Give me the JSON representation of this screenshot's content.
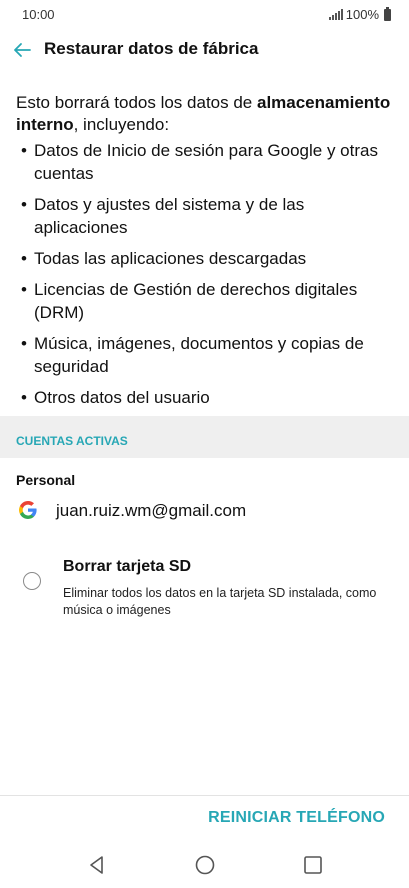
{
  "status": {
    "time": "10:00",
    "battery": "100%"
  },
  "appbar": {
    "title": "Restaurar datos de fábrica"
  },
  "intro": {
    "text_prefix": "Esto borrará todos los datos de ",
    "text_bold": "almacenamiento interno",
    "text_suffix": ", incluyendo:"
  },
  "bullets": [
    "Datos de Inicio de sesión para Google y otras cuentas",
    "Datos y ajustes del sistema y de las aplicaciones",
    "Todas las aplicaciones descargadas",
    "Licencias de Gestión de derechos digitales (DRM)",
    "Música, imágenes, documentos y copias de seguridad",
    "Otros datos del usuario"
  ],
  "accounts": {
    "section_label": "CUENTAS ACTIVAS",
    "group_label": "Personal",
    "email": "juan.ruiz.wm@gmail.com"
  },
  "sd_option": {
    "title": "Borrar tarjeta SD",
    "description": "Eliminar todos los datos en la tarjeta SD instalada, como música o imágenes",
    "checked": false
  },
  "actions": {
    "reset_label": "REINICIAR TELÉFONO"
  },
  "colors": {
    "accent": "#27a7b5",
    "section_bg": "#efefef"
  }
}
